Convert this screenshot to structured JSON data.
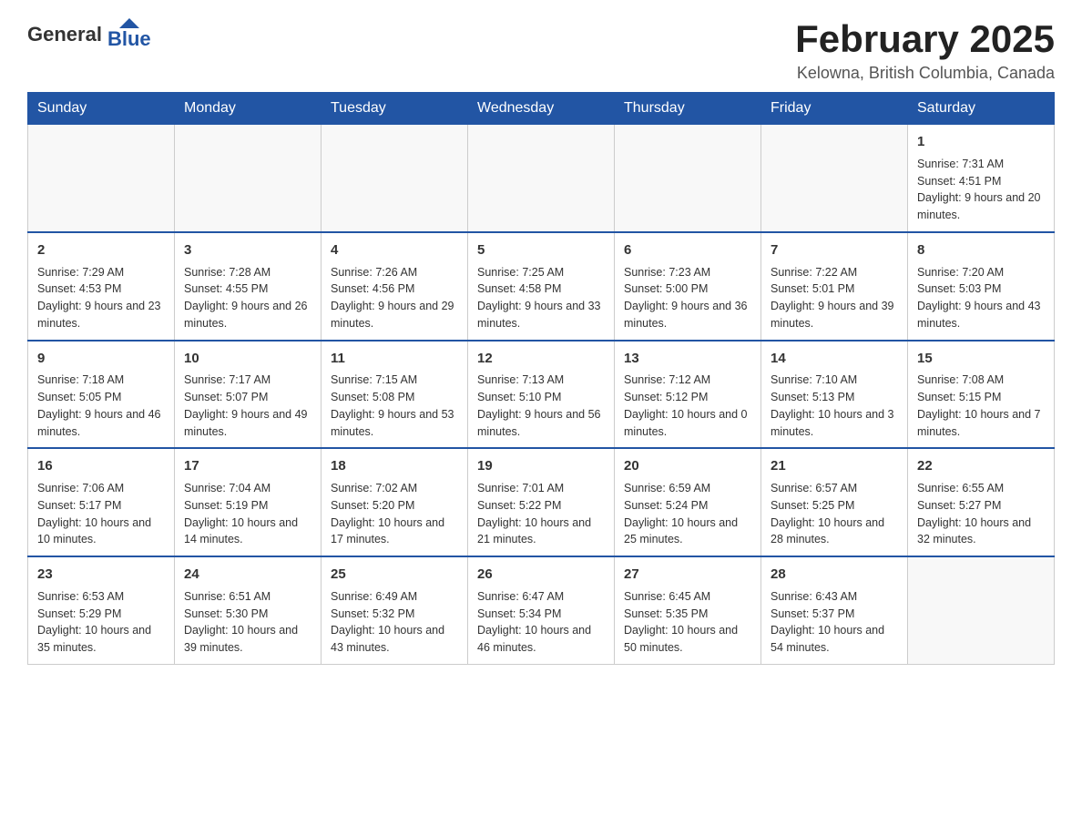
{
  "header": {
    "logo_general": "General",
    "logo_blue": "Blue",
    "month_title": "February 2025",
    "location": "Kelowna, British Columbia, Canada"
  },
  "weekdays": [
    "Sunday",
    "Monday",
    "Tuesday",
    "Wednesday",
    "Thursday",
    "Friday",
    "Saturday"
  ],
  "weeks": [
    [
      {
        "day": "",
        "info": ""
      },
      {
        "day": "",
        "info": ""
      },
      {
        "day": "",
        "info": ""
      },
      {
        "day": "",
        "info": ""
      },
      {
        "day": "",
        "info": ""
      },
      {
        "day": "",
        "info": ""
      },
      {
        "day": "1",
        "info": "Sunrise: 7:31 AM\nSunset: 4:51 PM\nDaylight: 9 hours and 20 minutes."
      }
    ],
    [
      {
        "day": "2",
        "info": "Sunrise: 7:29 AM\nSunset: 4:53 PM\nDaylight: 9 hours and 23 minutes."
      },
      {
        "day": "3",
        "info": "Sunrise: 7:28 AM\nSunset: 4:55 PM\nDaylight: 9 hours and 26 minutes."
      },
      {
        "day": "4",
        "info": "Sunrise: 7:26 AM\nSunset: 4:56 PM\nDaylight: 9 hours and 29 minutes."
      },
      {
        "day": "5",
        "info": "Sunrise: 7:25 AM\nSunset: 4:58 PM\nDaylight: 9 hours and 33 minutes."
      },
      {
        "day": "6",
        "info": "Sunrise: 7:23 AM\nSunset: 5:00 PM\nDaylight: 9 hours and 36 minutes."
      },
      {
        "day": "7",
        "info": "Sunrise: 7:22 AM\nSunset: 5:01 PM\nDaylight: 9 hours and 39 minutes."
      },
      {
        "day": "8",
        "info": "Sunrise: 7:20 AM\nSunset: 5:03 PM\nDaylight: 9 hours and 43 minutes."
      }
    ],
    [
      {
        "day": "9",
        "info": "Sunrise: 7:18 AM\nSunset: 5:05 PM\nDaylight: 9 hours and 46 minutes."
      },
      {
        "day": "10",
        "info": "Sunrise: 7:17 AM\nSunset: 5:07 PM\nDaylight: 9 hours and 49 minutes."
      },
      {
        "day": "11",
        "info": "Sunrise: 7:15 AM\nSunset: 5:08 PM\nDaylight: 9 hours and 53 minutes."
      },
      {
        "day": "12",
        "info": "Sunrise: 7:13 AM\nSunset: 5:10 PM\nDaylight: 9 hours and 56 minutes."
      },
      {
        "day": "13",
        "info": "Sunrise: 7:12 AM\nSunset: 5:12 PM\nDaylight: 10 hours and 0 minutes."
      },
      {
        "day": "14",
        "info": "Sunrise: 7:10 AM\nSunset: 5:13 PM\nDaylight: 10 hours and 3 minutes."
      },
      {
        "day": "15",
        "info": "Sunrise: 7:08 AM\nSunset: 5:15 PM\nDaylight: 10 hours and 7 minutes."
      }
    ],
    [
      {
        "day": "16",
        "info": "Sunrise: 7:06 AM\nSunset: 5:17 PM\nDaylight: 10 hours and 10 minutes."
      },
      {
        "day": "17",
        "info": "Sunrise: 7:04 AM\nSunset: 5:19 PM\nDaylight: 10 hours and 14 minutes."
      },
      {
        "day": "18",
        "info": "Sunrise: 7:02 AM\nSunset: 5:20 PM\nDaylight: 10 hours and 17 minutes."
      },
      {
        "day": "19",
        "info": "Sunrise: 7:01 AM\nSunset: 5:22 PM\nDaylight: 10 hours and 21 minutes."
      },
      {
        "day": "20",
        "info": "Sunrise: 6:59 AM\nSunset: 5:24 PM\nDaylight: 10 hours and 25 minutes."
      },
      {
        "day": "21",
        "info": "Sunrise: 6:57 AM\nSunset: 5:25 PM\nDaylight: 10 hours and 28 minutes."
      },
      {
        "day": "22",
        "info": "Sunrise: 6:55 AM\nSunset: 5:27 PM\nDaylight: 10 hours and 32 minutes."
      }
    ],
    [
      {
        "day": "23",
        "info": "Sunrise: 6:53 AM\nSunset: 5:29 PM\nDaylight: 10 hours and 35 minutes."
      },
      {
        "day": "24",
        "info": "Sunrise: 6:51 AM\nSunset: 5:30 PM\nDaylight: 10 hours and 39 minutes."
      },
      {
        "day": "25",
        "info": "Sunrise: 6:49 AM\nSunset: 5:32 PM\nDaylight: 10 hours and 43 minutes."
      },
      {
        "day": "26",
        "info": "Sunrise: 6:47 AM\nSunset: 5:34 PM\nDaylight: 10 hours and 46 minutes."
      },
      {
        "day": "27",
        "info": "Sunrise: 6:45 AM\nSunset: 5:35 PM\nDaylight: 10 hours and 50 minutes."
      },
      {
        "day": "28",
        "info": "Sunrise: 6:43 AM\nSunset: 5:37 PM\nDaylight: 10 hours and 54 minutes."
      },
      {
        "day": "",
        "info": ""
      }
    ]
  ]
}
